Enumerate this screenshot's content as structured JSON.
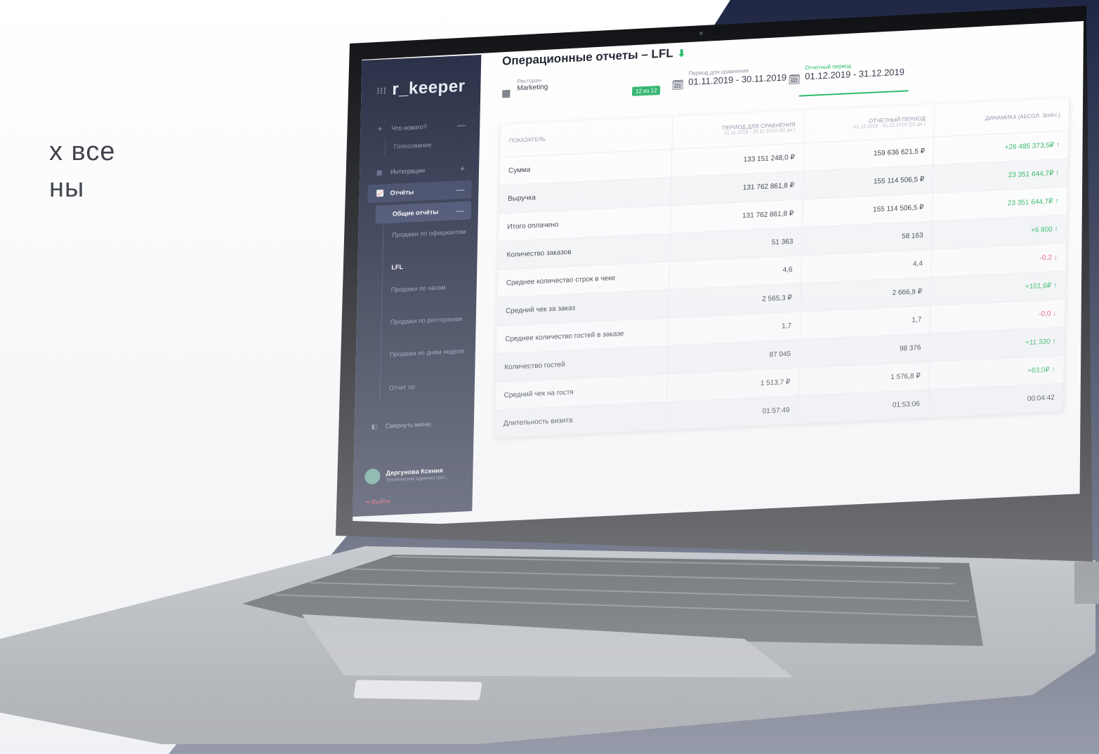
{
  "side_text": [
    "х все",
    "ны"
  ],
  "app": {
    "logo": "r_keeper",
    "title": "Операционные отчеты – LFL",
    "filters": {
      "restaurant_label": "Ресторан",
      "restaurant_value": "Marketing",
      "restaurant_count": "12 из 12",
      "compare_label": "Период для сравнения",
      "compare_value": "01.11.2019 - 30.11.2019",
      "report_label": "Отчетный период",
      "report_value": "01.12.2019 - 31.12.2019"
    },
    "sidebar": {
      "items": [
        {
          "label": "Что нового?",
          "sign": "—"
        },
        {
          "label": "Голосование",
          "sign": ""
        },
        {
          "label": "Интеграции",
          "sign": "+"
        },
        {
          "label": "Отчёты",
          "sign": "—"
        },
        {
          "label": "Общие отчёты",
          "sign": "—"
        }
      ],
      "subitems": [
        "Продажи по официантам",
        "LFL",
        "Продажи по часам",
        "Продажи по ресторанам",
        "Продажи по дням недели",
        "Отчет по"
      ],
      "collapse": "Свернуть меню",
      "user_name": "Дергунова Ксения",
      "user_role": "Технический администрат...",
      "logout": "Выйти"
    },
    "table": {
      "headers": {
        "indicator": "Показатель",
        "compare": "Период для сравнения",
        "compare_sub": "01.11.2019 - 30.11.2019 (30 дн.)",
        "report": "Отчетный период",
        "report_sub": "01.12.2019 - 31.12.2019 (31 дн.)",
        "dynamics": "Динамика (абсол. знач.)"
      },
      "rows": [
        {
          "name": "Сумма",
          "compare": "133 151 248,0 ₽",
          "report": "159 636 621,5 ₽",
          "dynamics": "+26 485 373,5₽ ↑",
          "trend": "pos"
        },
        {
          "name": "Выручка",
          "compare": "131 762 861,8 ₽",
          "report": "155 114 506,5 ₽",
          "dynamics": "23 351 644,7₽ ↑",
          "trend": "pos"
        },
        {
          "name": "Итого оплачено",
          "compare": "131 762 861,8 ₽",
          "report": "155 114 506,5 ₽",
          "dynamics": "23 351 644,7₽ ↑",
          "trend": "pos"
        },
        {
          "name": "Количество заказов",
          "compare": "51 363",
          "report": "58 163",
          "dynamics": "+6 800 ↑",
          "trend": "pos"
        },
        {
          "name": "Среднее количество строк в чеке",
          "compare": "4,6",
          "report": "4,4",
          "dynamics": "-0,2 ↓",
          "trend": "neg"
        },
        {
          "name": "Средний чек за заказ",
          "compare": "2 565,3 ₽",
          "report": "2 666,9 ₽",
          "dynamics": "+101,6₽ ↑",
          "trend": "pos"
        },
        {
          "name": "Среднее количество гостей в заказе",
          "compare": "1,7",
          "report": "1,7",
          "dynamics": "-0,0 ↓",
          "trend": "neg"
        },
        {
          "name": "Количество гостей",
          "compare": "87 045",
          "report": "98 376",
          "dynamics": "+11 330 ↑",
          "trend": "pos"
        },
        {
          "name": "Средний чек на гостя",
          "compare": "1 513,7 ₽",
          "report": "1 576,8 ₽",
          "dynamics": "+63,0₽ ↑",
          "trend": "pos"
        },
        {
          "name": "Длительность визита",
          "compare": "01:57:49",
          "report": "01:53:06",
          "dynamics": "00:04:42",
          "trend": "neu"
        }
      ]
    }
  }
}
